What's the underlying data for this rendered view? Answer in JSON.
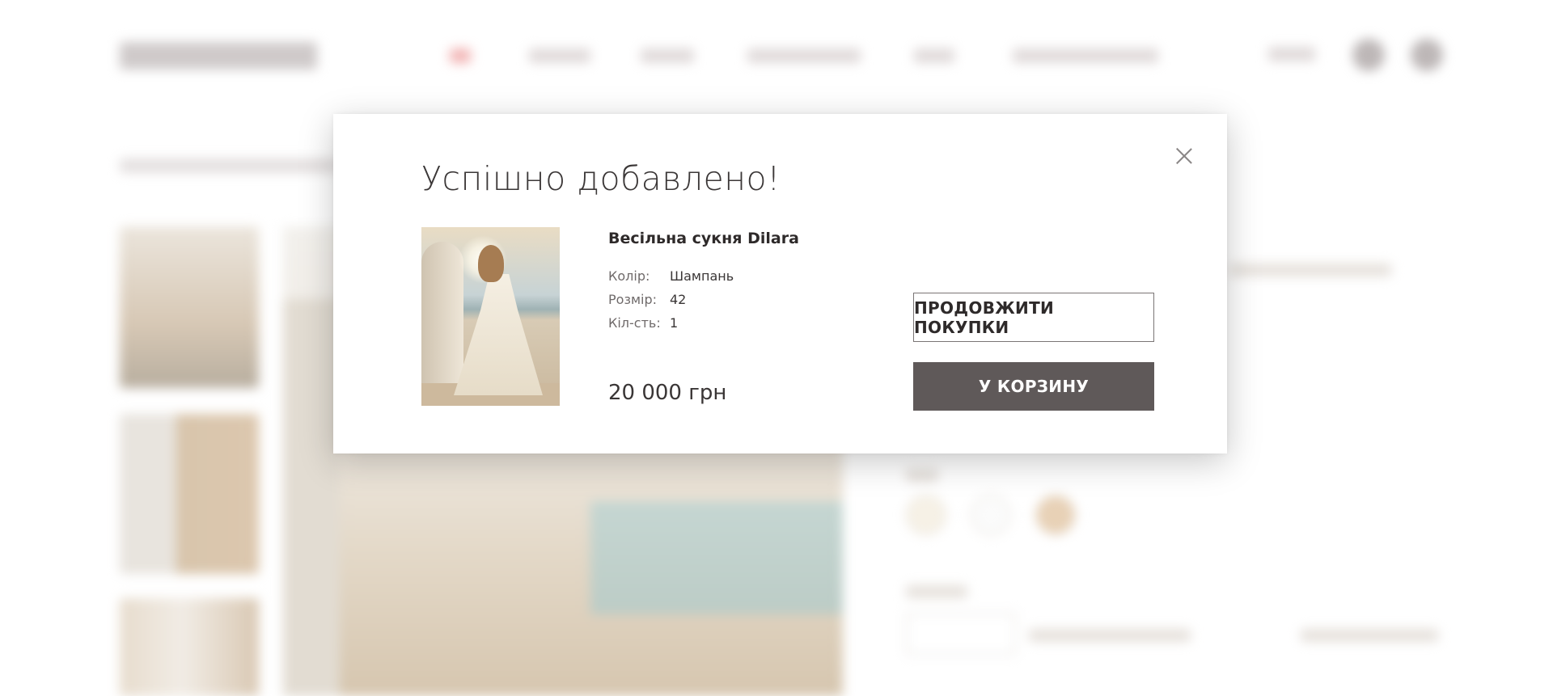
{
  "modal": {
    "title": "Успішно добавлено!",
    "product": {
      "name": "Весільна сукня Dilara",
      "attributes": [
        {
          "label": "Колір:",
          "value": "Шампань"
        },
        {
          "label": "Розмір:",
          "value": "42"
        },
        {
          "label": "Кіл-сть:",
          "value": "1"
        }
      ],
      "price": "20 000 грн"
    },
    "buttons": {
      "continue_label": "ПРОДОВЖИТИ ПОКУПКИ",
      "cart_label": "У КОРЗИНУ"
    }
  },
  "icons": {
    "close": "close-icon",
    "search": "search-icon",
    "cart": "cart-icon"
  }
}
